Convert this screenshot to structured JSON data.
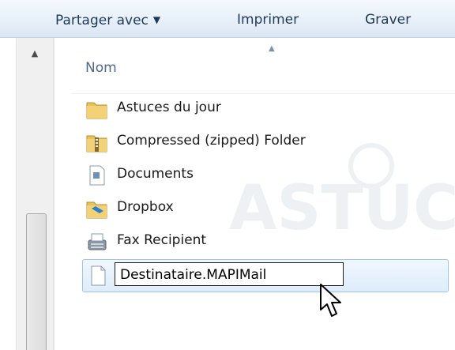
{
  "toolbar": {
    "share_label": "Partager avec",
    "print_label": "Imprimer",
    "burn_label": "Graver"
  },
  "column_header": {
    "name_label": "Nom"
  },
  "files": [
    {
      "label": "Astuces du jour",
      "icon": "folder-icon"
    },
    {
      "label": "Compressed (zipped) Folder",
      "icon": "zip-folder-icon"
    },
    {
      "label": "Documents",
      "icon": "document-icon"
    },
    {
      "label": "Dropbox",
      "icon": "dropbox-icon"
    },
    {
      "label": "Fax Recipient",
      "icon": "fax-icon"
    }
  ],
  "rename": {
    "value": "Destinataire.MAPIMail",
    "icon": "blank-file-icon"
  },
  "watermark": {
    "text": "ASTUCES"
  },
  "colors": {
    "toolbar_text": "#1e395b",
    "header_text": "#4f6a8a",
    "selection_border": "#9ec3ea",
    "folder_yellow": "#e8c35a"
  }
}
